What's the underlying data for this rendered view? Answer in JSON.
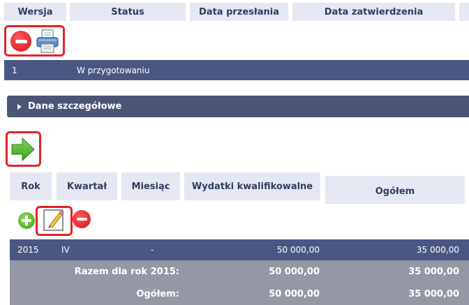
{
  "version_table": {
    "headers": [
      "Wersja",
      "Status",
      "Data przesłania",
      "Data zatwierdzenia"
    ],
    "row": {
      "version": "1",
      "status": "W przygotowaniu",
      "sent_date": "",
      "approved_date": ""
    }
  },
  "toolbar_icons": [
    "minus-icon",
    "print-icon"
  ],
  "section": {
    "title": "Dane szczegółowe",
    "icon": "triangle-right-icon"
  },
  "next_icon": "arrow-right-icon",
  "detail_table": {
    "headers": {
      "year": "Rok",
      "quarter": "Kwartał",
      "month": "Miesiąc",
      "eligible": "Wydatki kwalifikowalne",
      "total": "Ogółem"
    },
    "actions": [
      "plus-icon",
      "edit-icon",
      "minus-icon"
    ],
    "row": {
      "year": "2015",
      "quarter": "IV",
      "month": "-",
      "eligible": "50 000,00",
      "total": "35 000,00"
    },
    "year_sum": {
      "label": "Razem dla rok 2015:",
      "eligible": "50 000,00",
      "total": "35 000,00"
    },
    "grand_total": {
      "label": "Ogółem:",
      "eligible": "50 000,00",
      "total": "35 000,00"
    }
  },
  "colors": {
    "header_bg": "#e5e8f2",
    "dark_row": "#4a5783",
    "section_bar": "#4b5575",
    "summary_row": "#9497a4",
    "highlight_red": "#e2232a",
    "green": "#5bb52f"
  }
}
